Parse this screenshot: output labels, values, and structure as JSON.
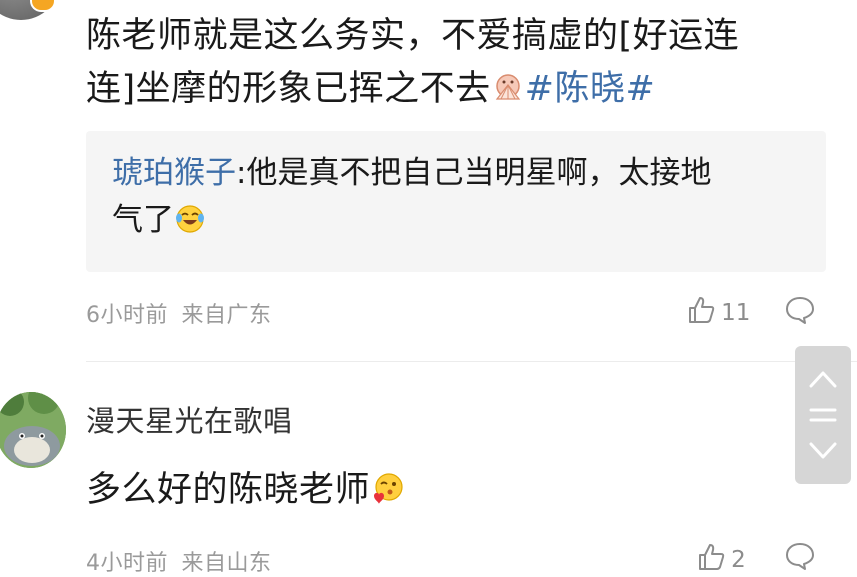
{
  "comment1": {
    "text_line1": "陈老师就是这么务实，不爱搞虚的[好运连",
    "text_line2": "连]坐摩的形象已挥之不去",
    "topic": "#陈晓#",
    "reply": {
      "user": "琥珀猴子",
      "text_line1": ":他是真不把自己当明星啊，太接地",
      "text_line2": "气了"
    },
    "time": "6小时前",
    "source": "来自广东",
    "likes": "11"
  },
  "comment2": {
    "username": "漫天星光在歌唱",
    "text": "多么好的陈晓老师",
    "time": "4小时前",
    "source": "来自山东",
    "likes": "2"
  },
  "icons": {
    "like": "thumbs-up-icon",
    "reply": "comment-bubble-icon",
    "scroll_up": "chevron-up-icon",
    "scroll_handle": "drag-handle-icon",
    "scroll_down": "chevron-down-icon"
  },
  "colors": {
    "topic_link": "#3e6ea8",
    "meta_text": "#9a9a9a",
    "quote_bg": "#f5f5f5",
    "scroll_bg": "#d6d6d6"
  }
}
